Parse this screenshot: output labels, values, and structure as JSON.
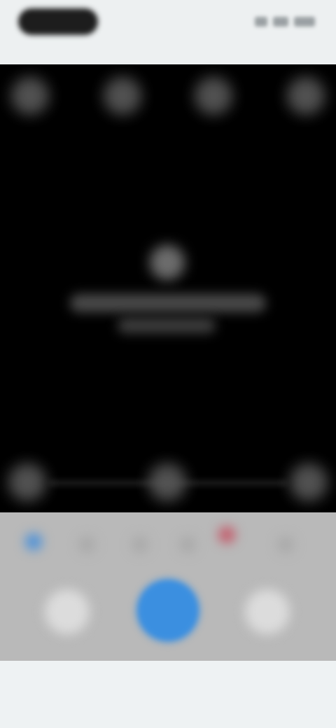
{
  "app": {
    "title": ""
  },
  "status_bar": {
    "time": "",
    "indicators": [
      "signal-icon",
      "wifi-icon",
      "battery-icon"
    ]
  },
  "viewfinder": {
    "top_controls": [
      "flash-icon",
      "timer-icon",
      "hdr-icon",
      "settings-icon"
    ],
    "message_icon": "camera-off-icon",
    "message_text": "",
    "bottom_controls": [
      "left-lens-icon",
      "zoom-icon",
      "right-lens-icon"
    ]
  },
  "control_panel": {
    "modes": [
      {
        "name": "mode-1",
        "color": "#4a90d9"
      },
      {
        "name": "mode-2",
        "color": "#a9a9a9"
      },
      {
        "name": "mode-3",
        "color": "#a9a9a9"
      },
      {
        "name": "mode-4",
        "color": "#a9a9a9"
      },
      {
        "name": "mode-5",
        "color": "#c45a6a"
      },
      {
        "name": "mode-6",
        "color": "#a9a9a9"
      }
    ],
    "shutter_color": "#3b8fe0",
    "left_button": "gallery-icon",
    "right_button": "switch-camera-icon"
  }
}
